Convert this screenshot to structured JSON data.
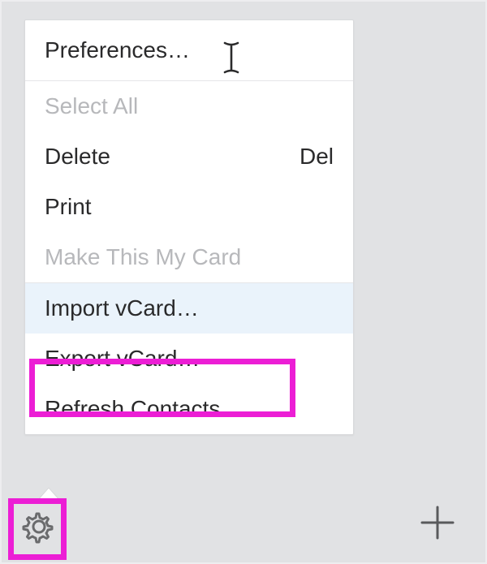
{
  "menu": {
    "preferences": "Preferences…",
    "select_all": "Select All",
    "delete": "Delete",
    "delete_shortcut": "Del",
    "print": "Print",
    "make_my_card": "Make This My Card",
    "import_vcard": "Import vCard…",
    "export_vcard": "Export vCard…",
    "refresh_contacts": "Refresh Contacts"
  },
  "annotation": {
    "highlight_color": "#ec1ed5"
  }
}
